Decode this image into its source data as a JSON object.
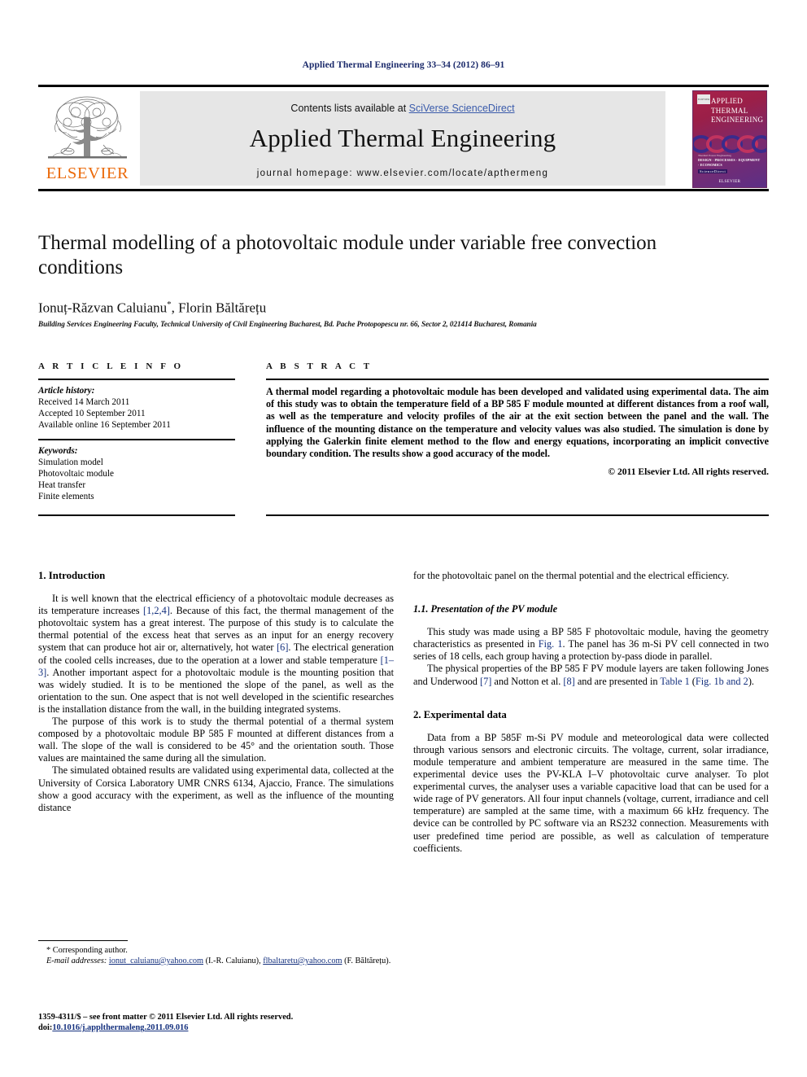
{
  "running_head": "Applied Thermal Engineering 33–34 (2012) 86–91",
  "masthead": {
    "contents_prefix": "Contents lists available at ",
    "contents_link": "SciVerse ScienceDirect",
    "journal_name": "Applied Thermal Engineering",
    "homepage": "journal homepage: www.elsevier.com/locate/apthermeng",
    "publisher_wordmark": "ELSEVIER",
    "cover": {
      "line1": "APPLIED",
      "line2": "THERMAL",
      "line3": "ENGINEERING",
      "foot_small": "Thermal Power Engineering",
      "foot_topics": "DESIGN · PROCESSES · EQUIPMENT · ECONOMICS",
      "foot_bar": "ScienceDirect",
      "brand": "ELSEVIER",
      "logo_label": "ELSEVIER"
    },
    "colors": {
      "link_blue": "#3a5bab",
      "elsevier_orange": "#eb6a0a",
      "band_grey": "#e6e6e6"
    }
  },
  "article": {
    "title": "Thermal modelling of a photovoltaic module under variable free convection conditions",
    "authors": "Ionuț-Răzvan Caluianu",
    "authors_marker": "*",
    "authors_rest": ", Florin Băltărețu",
    "affiliation": "Building Services Engineering Faculty, Technical University of Civil Engineering Bucharest, Bd. Pache Protopopescu nr. 66, Sector 2, 021414 Bucharest, Romania"
  },
  "article_info": {
    "heading": "A R T I C L E  I N F O",
    "history_label": "Article history:",
    "history": [
      "Received 14 March 2011",
      "Accepted 10 September 2011",
      "Available online 16 September 2011"
    ],
    "keywords_label": "Keywords:",
    "keywords": [
      "Simulation model",
      "Photovoltaic module",
      "Heat transfer",
      "Finite elements"
    ]
  },
  "abstract": {
    "heading": "A B S T R A C T",
    "text": "A thermal model regarding a photovoltaic module has been developed and validated using experimental data. The aim of this study was to obtain the temperature field of a BP 585 F module mounted at different distances from a roof wall, as well as the temperature and velocity profiles of the air at the exit section between the panel and the wall. The influence of the mounting distance on the temperature and velocity values was also studied. The simulation is done by applying the Galerkin finite element method to the flow and energy equations, incorporating an implicit convective boundary condition. The results show a good accuracy of the model.",
    "copyright": "© 2011 Elsevier Ltd. All rights reserved."
  },
  "body": {
    "left": {
      "section1_heading": "1.  Introduction",
      "p1_a": "It is well known that the electrical efficiency of a photovoltaic module decreases as its temperature increases ",
      "p1_ref1": "[1,2,4]",
      "p1_b": ". Because of this fact, the thermal management of the photovoltaic system has a great interest. The purpose of this study is to calculate the thermal potential of the excess heat that serves as an input for an energy recovery system that can produce hot air or, alternatively, hot water ",
      "p1_ref2": "[6]",
      "p1_c": ". The electrical generation of the cooled cells increases, due to the operation at a lower and stable temperature ",
      "p1_ref3": "[1–3]",
      "p1_d": ". Another important aspect for a photovoltaic module is the mounting position that was widely studied. It is to be mentioned the slope of the panel, as well as the orientation to the sun. One aspect that is not well developed in the scientific researches is the installation distance from the wall, in the building integrated systems.",
      "p2": "The purpose of this work is to study the thermal potential of a thermal system composed by a photovoltaic module BP 585 F mounted at different distances from a wall. The slope of the wall is considered to be 45° and the orientation south. Those values are maintained the same during all the simulation.",
      "p3": "The simulated obtained results are validated using experimental data, collected at the University of Corsica Laboratory UMR CNRS 6134, Ajaccio, France. The simulations show a good accuracy with the experiment, as well as the influence of the mounting distance"
    },
    "right": {
      "p1": "for the photovoltaic panel on the thermal potential and the electrical efficiency.",
      "section11_heading": "1.1.  Presentation of the PV module",
      "p2_a": "This study was made using a BP 585 F photovoltaic module, having the geometry characteristics as presented in ",
      "p2_ref1": "Fig. 1",
      "p2_b": ". The panel has 36 m-Si PV cell connected in two series of 18 cells, each group having a protection by-pass diode in parallel.",
      "p3_a": "The physical properties of the BP 585 F PV module layers are taken following Jones and Underwood ",
      "p3_ref1": "[7]",
      "p3_b": " and Notton et al. ",
      "p3_ref2": "[8]",
      "p3_c": " and are presented in ",
      "p3_ref3": "Table 1",
      "p3_d": " (",
      "p3_ref4": "Fig. 1b and 2",
      "p3_e": ").",
      "section2_heading": "2.  Experimental data",
      "p4": "Data from a BP 585F m-Si PV module and meteorological data were collected through various sensors and electronic circuits. The voltage, current, solar irradiance, module temperature and ambient temperature are measured in the same time. The experimental device uses the PV-KLA I–V photovoltaic curve analyser. To plot experimental curves, the analyser uses a variable capacitive load that can be used for a wide rage of PV generators. All four input channels (voltage, current, irradiance and cell temperature) are sampled at the same time, with a maximum 66 kHz frequency. The device can be controlled by PC software via an RS232 connection. Measurements with user predefined time period are possible, as well as calculation of temperature coefficients."
    }
  },
  "footnote": {
    "corresponding": "* Corresponding author.",
    "email_label": "E-mail addresses:",
    "email1": "ionut_caluianu@yahoo.com",
    "email1_owner": "(I.-R. Caluianu)",
    "email2": "flbaltaretu@yahoo.com",
    "email2_owner": "(F. Băltărețu)."
  },
  "page_footer": {
    "issn_line": "1359-4311/$ – see front matter © 2011 Elsevier Ltd. All rights reserved.",
    "doi_prefix": "doi:",
    "doi": "10.1016/j.applthermaleng.2011.09.016"
  }
}
